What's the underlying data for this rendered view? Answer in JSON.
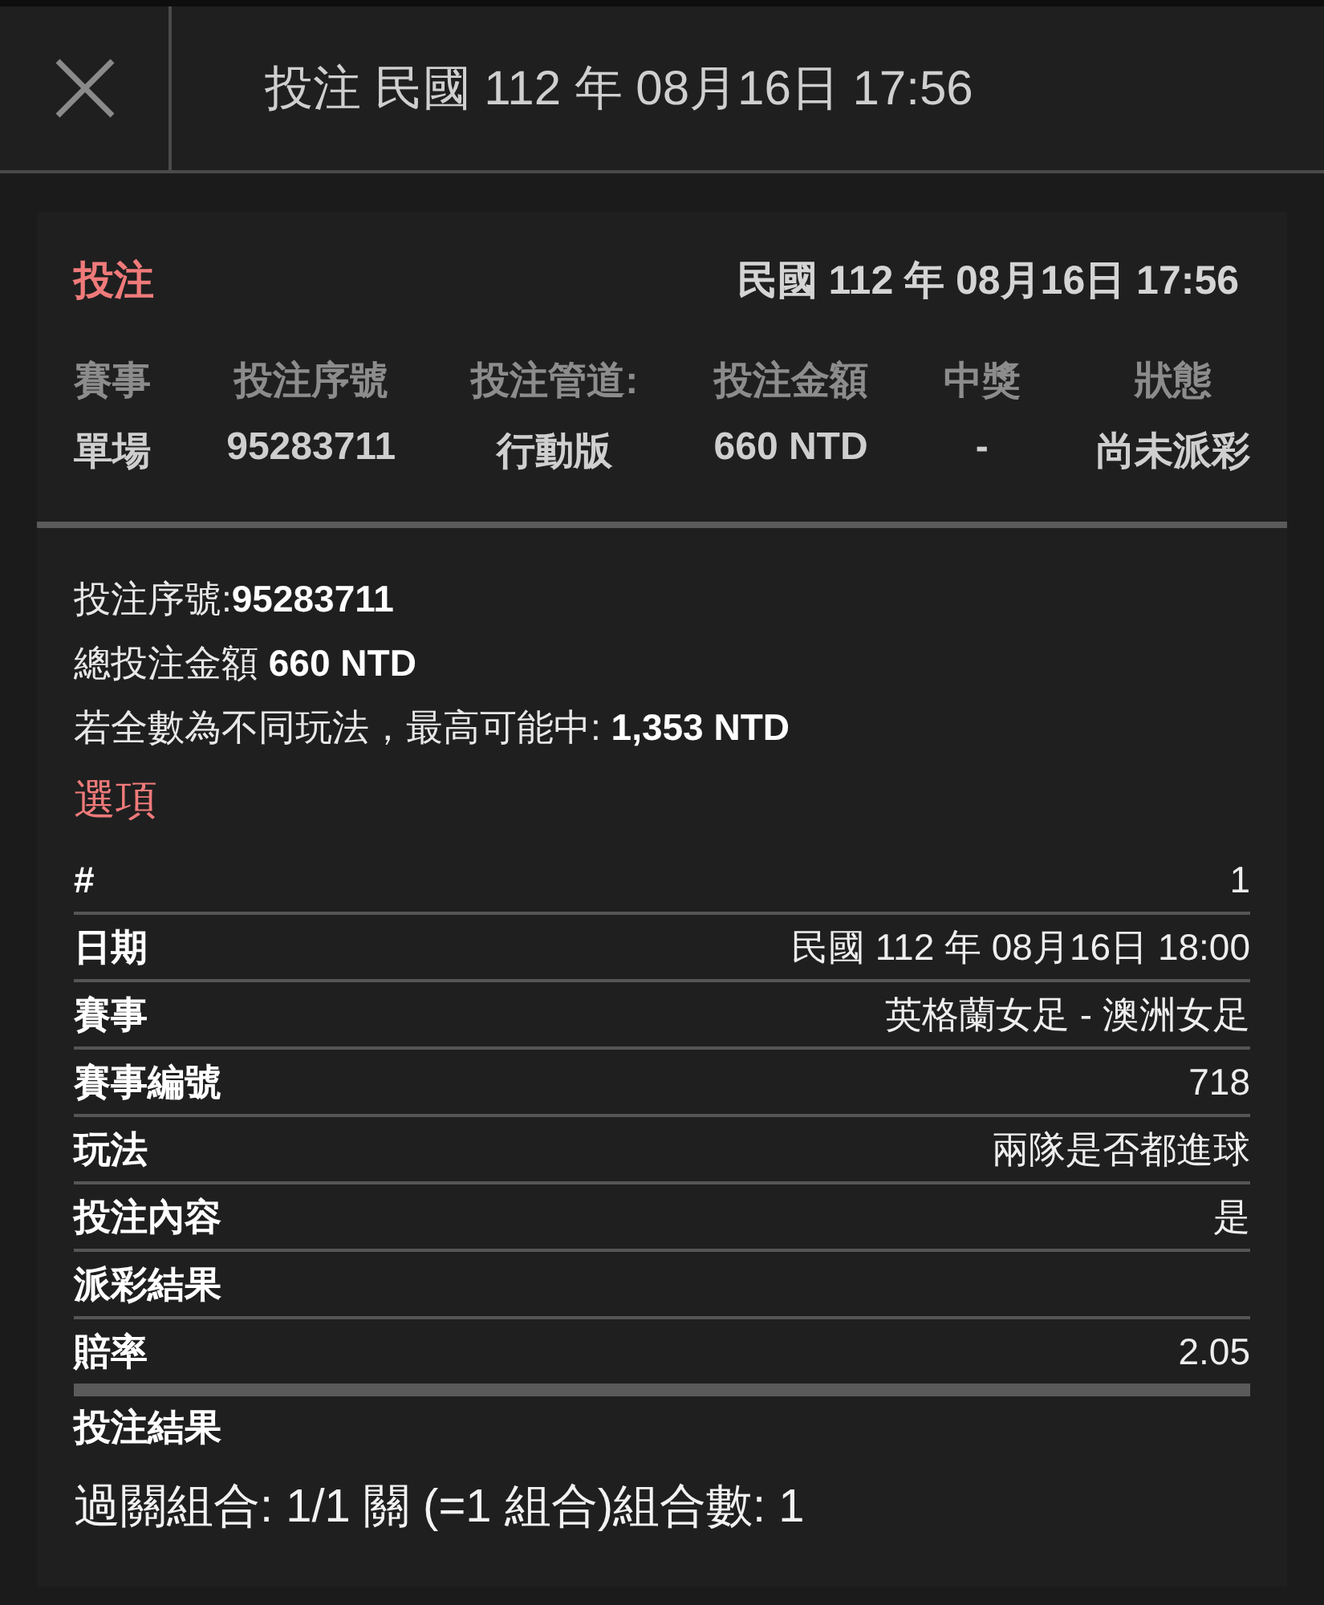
{
  "header": {
    "title": "投注 民國 112 年 08月16日 17:56"
  },
  "card": {
    "title": "投注",
    "datetime": "民國 112 年 08月16日 17:56",
    "columns": [
      {
        "label": "賽事",
        "value": "單場"
      },
      {
        "label": "投注序號",
        "value": "95283711"
      },
      {
        "label": "投注管道:",
        "value": "行動版"
      },
      {
        "label": "投注金額",
        "value": "660 NTD"
      },
      {
        "label": "中獎",
        "value": "-"
      },
      {
        "label": "狀態",
        "value": "尚未派彩"
      }
    ],
    "summary": [
      "投注序號:**95283711**",
      "總投注金額 **660 NTD**",
      "若全數為不同玩法，最高可能中: **1,353 NTD**"
    ],
    "options_title": "選項",
    "details": [
      {
        "label": "#",
        "value": "1"
      },
      {
        "label": "日期",
        "value": "民國 112 年 08月16日 18:00"
      },
      {
        "label": "賽事",
        "value": "英格蘭女足 - 澳洲女足"
      },
      {
        "label": "賽事編號",
        "value": "718"
      },
      {
        "label": "玩法",
        "value": "兩隊是否都進球"
      },
      {
        "label": "投注內容",
        "value": "是"
      },
      {
        "label": "派彩結果"
      },
      {
        "label": "賠率",
        "value": "2.05"
      }
    ],
    "result_title": "投注結果",
    "result_text": "過關組合: 1/1 關 (=1 組合)組合數: 1"
  }
}
